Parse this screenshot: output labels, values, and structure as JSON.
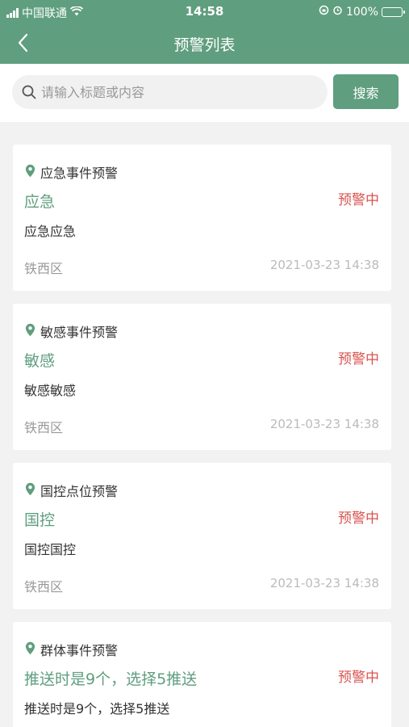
{
  "status_bar": {
    "carrier": "中国联通",
    "time": "14:58",
    "battery": "100%"
  },
  "nav": {
    "title": "预警列表"
  },
  "search": {
    "placeholder": "请输入标题或内容",
    "value": "",
    "button_label": "搜索"
  },
  "colors": {
    "brand": "#5f9e7e",
    "status": "#d9534f"
  },
  "warnings": [
    {
      "type": "应急事件预警",
      "title": "应急",
      "status": "预警中",
      "content": "应急应急",
      "area": "铁西区",
      "time": "2021-03-23 14:38"
    },
    {
      "type": "敏感事件预警",
      "title": "敏感",
      "status": "预警中",
      "content": "敏感敏感",
      "area": "铁西区",
      "time": "2021-03-23 14:38"
    },
    {
      "type": "国控点位预警",
      "title": "国控",
      "status": "预警中",
      "content": "国控国控",
      "area": "铁西区",
      "time": "2021-03-23 14:38"
    },
    {
      "type": "群体事件预警",
      "title": "推送时是9个，选择5推送",
      "status": "预警中",
      "content": "推送时是9个，选择5推送",
      "area": "",
      "time": ""
    }
  ]
}
